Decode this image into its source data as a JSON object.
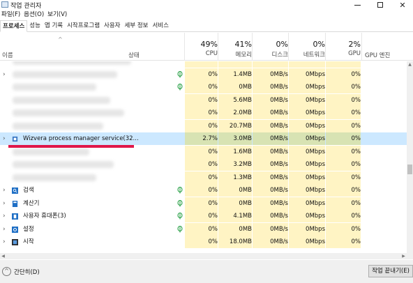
{
  "window": {
    "title": "작업 관리자",
    "min_glyph": "─",
    "max_glyph": "□",
    "close_glyph": "✕"
  },
  "menu": [
    "파일(F)",
    "옵션(O)",
    "보기(V)"
  ],
  "tabs": [
    "프로세스",
    "성능",
    "앱 기록",
    "시작프로그램",
    "사용자",
    "세부 정보",
    "서비스"
  ],
  "header": {
    "sort_arrow": "^",
    "name": "이름",
    "status": "상태",
    "cpu": {
      "pct": "49%",
      "label": "CPU"
    },
    "memory": {
      "pct": "41%",
      "label": "메모리"
    },
    "disk": {
      "pct": "0%",
      "label": "디스크"
    },
    "network": {
      "pct": "0%",
      "label": "네트워크"
    },
    "gpu": {
      "pct": "2%",
      "label": "GPU"
    },
    "gpu_engine": "GPU 엔진"
  },
  "rows": [
    {
      "name": "",
      "blurred": true,
      "expander": "",
      "eco": false,
      "cpu": "",
      "mem": "",
      "disk": "",
      "net": "",
      "gpu": ""
    },
    {
      "name": "",
      "blurred": true,
      "expander": "›",
      "eco": true,
      "cpu": "0%",
      "mem": "1.4MB",
      "disk": "0MB/s",
      "net": "0Mbps",
      "gpu": "0%"
    },
    {
      "name": "",
      "blurred": true,
      "expander": "",
      "eco": true,
      "cpu": "0%",
      "mem": "0MB",
      "disk": "0MB/s",
      "net": "0Mbps",
      "gpu": "0%"
    },
    {
      "name": "",
      "blurred": true,
      "expander": "",
      "eco": false,
      "cpu": "0%",
      "mem": "5.6MB",
      "disk": "0MB/s",
      "net": "0Mbps",
      "gpu": "0%"
    },
    {
      "name": "",
      "blurred": true,
      "expander": "",
      "eco": false,
      "cpu": "0%",
      "mem": "2.0MB",
      "disk": "0MB/s",
      "net": "0Mbps",
      "gpu": "0%"
    },
    {
      "name": "",
      "blurred": true,
      "expander": "",
      "eco": false,
      "cpu": "0%",
      "mem": "20.7MB",
      "disk": "0MB/s",
      "net": "0Mbps",
      "gpu": "0%"
    },
    {
      "name": "Wizvera process manager service(32...",
      "blurred": false,
      "highlight": true,
      "expander": "›",
      "icon": "service-icon",
      "eco": false,
      "cpu": "2.7%",
      "mem": "3.0MB",
      "disk": "0MB/s",
      "net": "0Mbps",
      "gpu": "0%"
    },
    {
      "name": "",
      "blurred": true,
      "expander": "",
      "eco": false,
      "cpu": "0%",
      "mem": "1.6MB",
      "disk": "0MB/s",
      "net": "0Mbps",
      "gpu": "0%"
    },
    {
      "name": "",
      "blurred": true,
      "expander": "",
      "eco": false,
      "cpu": "0%",
      "mem": "3.2MB",
      "disk": "0MB/s",
      "net": "0Mbps",
      "gpu": "0%"
    },
    {
      "name": "",
      "blurred": true,
      "expander": "",
      "eco": false,
      "cpu": "0%",
      "mem": "1.3MB",
      "disk": "0MB/s",
      "net": "0Mbps",
      "gpu": "0%"
    },
    {
      "name": "검색",
      "blurred": false,
      "expander": "›",
      "icon": "search-app-icon",
      "eco": true,
      "cpu": "0%",
      "mem": "0MB",
      "disk": "0MB/s",
      "net": "0Mbps",
      "gpu": "0%"
    },
    {
      "name": "계산기",
      "blurred": false,
      "expander": "›",
      "icon": "calculator-icon",
      "eco": true,
      "cpu": "0%",
      "mem": "0MB",
      "disk": "0MB/s",
      "net": "0Mbps",
      "gpu": "0%"
    },
    {
      "name": "사용자 휴대폰(3)",
      "blurred": false,
      "expander": "›",
      "icon": "phone-icon",
      "eco": true,
      "cpu": "0%",
      "mem": "4.1MB",
      "disk": "0MB/s",
      "net": "0Mbps",
      "gpu": "0%"
    },
    {
      "name": "설정",
      "blurred": false,
      "expander": "›",
      "icon": "settings-gear-icon",
      "eco": true,
      "cpu": "0%",
      "mem": "0MB",
      "disk": "0MB/s",
      "net": "0Mbps",
      "gpu": "0%"
    },
    {
      "name": "시작",
      "blurred": false,
      "expander": "›",
      "icon": "start-icon",
      "eco": false,
      "cpu": "0%",
      "mem": "18.0MB",
      "disk": "0MB/s",
      "net": "0Mbps",
      "gpu": "0%"
    }
  ],
  "footer": {
    "fewer_details": "간단히(D)",
    "end_task": "작업 끝내기(E)"
  },
  "colors": {
    "highlight": "#cce8ff",
    "usage_yellow": "#fff4c4",
    "annotation_red": "#e0174a",
    "eco_green": "#1a9a3a"
  }
}
